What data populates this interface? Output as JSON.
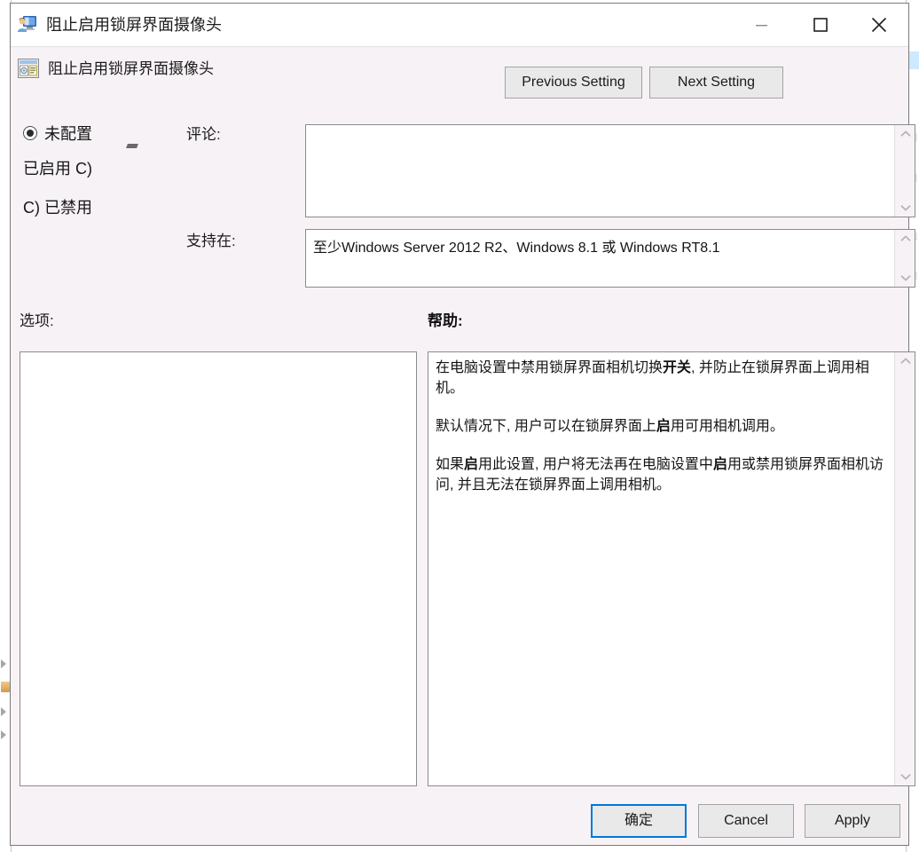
{
  "window": {
    "title": "阻止启用锁屏界面摄像头",
    "title_icon": "user-monitor-icon",
    "minimize_label": "minimize-icon",
    "maximize_label": "maximize-icon",
    "close_label": "close-icon"
  },
  "header": {
    "policy_icon": "policy-setting-icon",
    "policy_title": "阻止启用锁屏界面摄像头",
    "previous_setting": "Previous Setting",
    "next_setting": "Next Setting"
  },
  "state": {
    "options": [
      {
        "label": "未配置",
        "selected": true
      },
      {
        "label": "已启用 C)",
        "selected": false
      },
      {
        "label": "C) 已禁用",
        "selected": false
      }
    ]
  },
  "fields": {
    "comment_label": "评论:",
    "comment_value": "",
    "comment_placeholder": "",
    "supported_label": "支持在:",
    "supported_value": "至少Windows Server 2012 R2、Windows 8.1 或 Windows RT8.1"
  },
  "panes": {
    "options_label": "选项:",
    "help_label": "帮助:",
    "options_content": "",
    "help_paragraphs": [
      {
        "runs": [
          {
            "text": "在电脑设置中禁用锁屏界面相机切换",
            "bold": false
          },
          {
            "text": "开关",
            "bold": true
          },
          {
            "text": ", 并防止在锁屏界面上调用相机。",
            "bold": false
          }
        ]
      },
      {
        "runs": [
          {
            "text": "默认情况下, 用户可以在锁屏界面上",
            "bold": false
          },
          {
            "text": "启",
            "bold": true
          },
          {
            "text": "用可用相机调用。",
            "bold": false
          }
        ]
      },
      {
        "runs": [
          {
            "text": "如果",
            "bold": false
          },
          {
            "text": "启",
            "bold": true
          },
          {
            "text": "用此设置, 用户将无法再在电脑设置中",
            "bold": false
          },
          {
            "text": "启",
            "bold": true
          },
          {
            "text": "用或禁用锁屏界面相机访问, 并且无法在锁屏界面上调用相机。",
            "bold": false
          }
        ]
      }
    ]
  },
  "footer": {
    "ok": "确定",
    "cancel": "Cancel",
    "apply": "Apply"
  },
  "colors": {
    "dialog_background": "#f7f2f5",
    "titlebar_background": "#ffffff",
    "button_face": "#e9e9e9",
    "focus_accent": "#0078d7",
    "field_background": "#ffffff",
    "border": "#8b8b8b"
  },
  "scrollbars": {
    "up_arrow": "chevron-up-icon",
    "down_arrow": "chevron-down-icon"
  }
}
